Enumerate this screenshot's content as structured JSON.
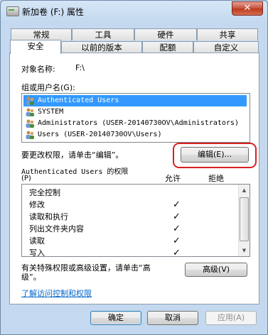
{
  "window": {
    "title": "新加卷 (F:) 属性",
    "close_label": "✕"
  },
  "tabs": {
    "row1": [
      "常规",
      "工具",
      "硬件",
      "共享"
    ],
    "row2": [
      "安全",
      "以前的版本",
      "配额",
      "自定义"
    ]
  },
  "security": {
    "object_name_label": "对象名称:",
    "object_name_value": "F:\\",
    "principals_label": "组或用户名(G):",
    "principals": [
      "Authenticated Users",
      "SYSTEM",
      "Administrators (USER-20140730OV\\Administrators)",
      "Users (USER-20140730OV\\Users)"
    ],
    "change_hint": "要更改权限，请单击“编辑”。",
    "edit_button": "编辑(E)...",
    "permissions_for": "Authenticated Users 的权限",
    "permissions_accel": "(P)",
    "allow_header": "允许",
    "deny_header": "拒绝",
    "permissions": [
      {
        "name": "完全控制",
        "allow": ""
      },
      {
        "name": "修改",
        "allow": "✓"
      },
      {
        "name": "读取和执行",
        "allow": "✓"
      },
      {
        "name": "列出文件夹内容",
        "allow": "✓"
      },
      {
        "name": "读取",
        "allow": "✓"
      },
      {
        "name": "写入",
        "allow": "✓"
      }
    ],
    "advanced_hint_line1": "有关特殊权限或高级设置，请单击“高",
    "advanced_hint_line2": "级”。",
    "advanced_button": "高级(V)",
    "learn_link": "了解访问控制和权限"
  },
  "footer": {
    "ok": "确定",
    "cancel": "取消",
    "apply": "应用(A)"
  },
  "colors": {
    "selection": "#3399ff",
    "highlight_ring": "#d92020",
    "link": "#0066cc"
  }
}
